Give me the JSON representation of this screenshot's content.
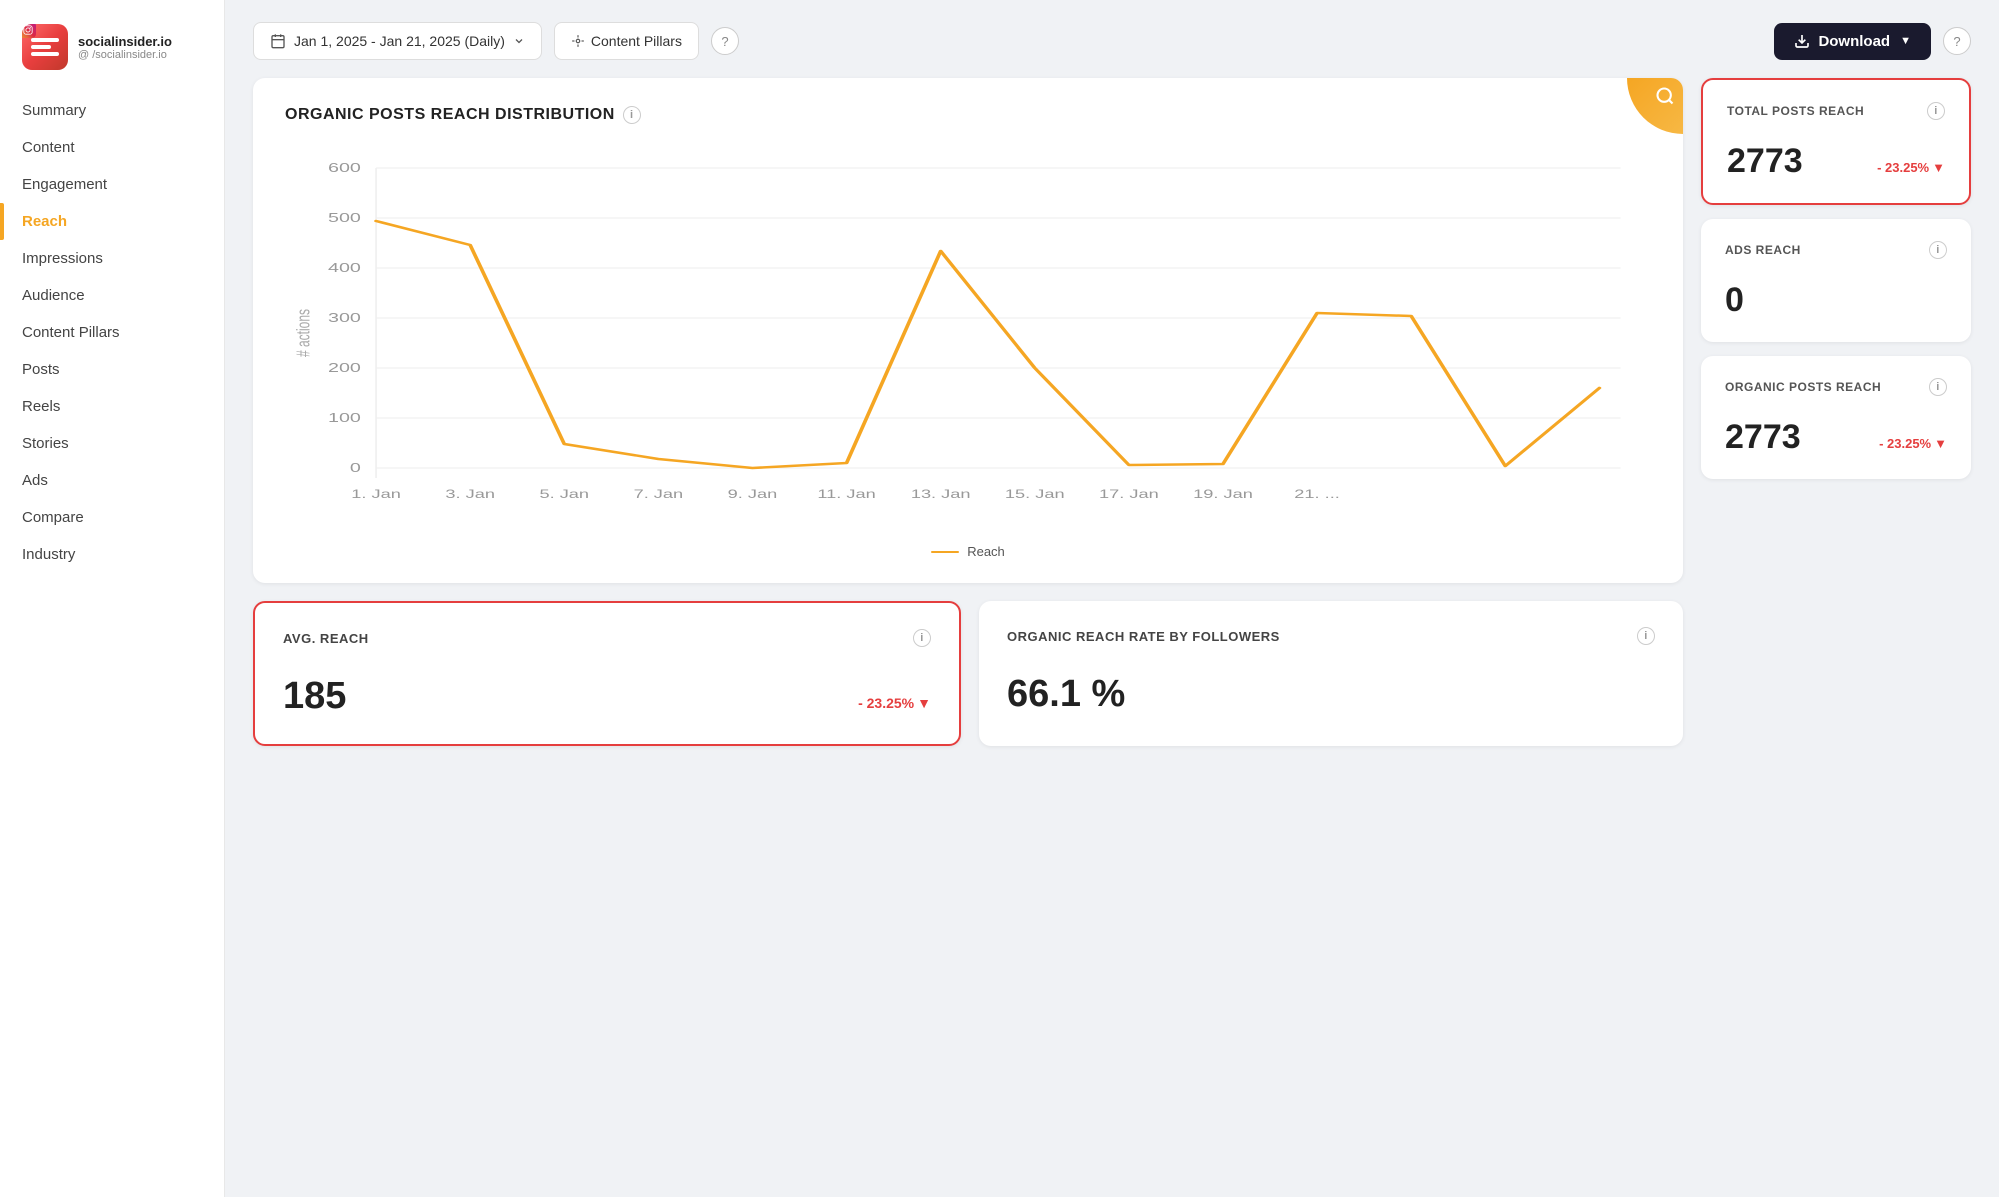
{
  "app": {
    "logo_name": "socialinsider.io",
    "logo_handle": "@ /socialinsider.io"
  },
  "nav": {
    "items": [
      {
        "id": "summary",
        "label": "Summary",
        "active": false
      },
      {
        "id": "content",
        "label": "Content",
        "active": false
      },
      {
        "id": "engagement",
        "label": "Engagement",
        "active": false
      },
      {
        "id": "reach",
        "label": "Reach",
        "active": true
      },
      {
        "id": "impressions",
        "label": "Impressions",
        "active": false
      },
      {
        "id": "audience",
        "label": "Audience",
        "active": false
      },
      {
        "id": "content-pillars",
        "label": "Content Pillars",
        "active": false
      },
      {
        "id": "posts",
        "label": "Posts",
        "active": false
      },
      {
        "id": "reels",
        "label": "Reels",
        "active": false
      },
      {
        "id": "stories",
        "label": "Stories",
        "active": false
      },
      {
        "id": "ads",
        "label": "Ads",
        "active": false
      },
      {
        "id": "compare",
        "label": "Compare",
        "active": false
      },
      {
        "id": "industry",
        "label": "Industry",
        "active": false
      }
    ]
  },
  "topbar": {
    "date_range": "Jan 1, 2025 - Jan 21, 2025 (Daily)",
    "content_pillars_label": "Content Pillars",
    "download_label": "Download",
    "help_label": "?"
  },
  "chart": {
    "title": "ORGANIC POSTS REACH DISTRIBUTION",
    "legend_label": "Reach",
    "y_axis_label": "# actions",
    "y_ticks": [
      "0",
      "100",
      "200",
      "300",
      "400",
      "500",
      "600"
    ],
    "x_labels": [
      "1. Jan",
      "3. Jan",
      "5. Jan",
      "7. Jan",
      "9. Jan",
      "11. Jan",
      "13. Jan",
      "15. Jan",
      "17. Jan",
      "19. Jan",
      "21. ..."
    ]
  },
  "right_stats": [
    {
      "id": "total-posts-reach",
      "label": "TOTAL POSTS REACH",
      "value": "2773",
      "delta": "- 23.25%",
      "highlighted": true
    },
    {
      "id": "ads-reach",
      "label": "ADS REACH",
      "value": "0",
      "delta": "",
      "highlighted": false
    },
    {
      "id": "organic-posts-reach",
      "label": "ORGANIC POSTS REACH",
      "value": "2773",
      "delta": "- 23.25%",
      "highlighted": false
    }
  ],
  "bottom_cards": [
    {
      "id": "avg-reach",
      "label": "AVG. REACH",
      "value": "185",
      "delta": "- 23.25%",
      "highlighted": true
    },
    {
      "id": "organic-reach-rate",
      "label": "ORGANIC REACH RATE BY FOLLOWERS",
      "value": "66.1 %",
      "delta": "",
      "highlighted": false
    }
  ]
}
